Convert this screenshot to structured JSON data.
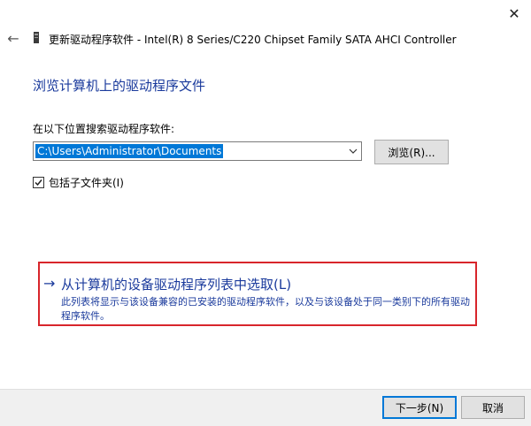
{
  "window": {
    "title": "更新驱动程序软件 - Intel(R) 8 Series/C220 Chipset Family SATA AHCI Controller",
    "close_glyph": "✕",
    "back_glyph": "←"
  },
  "page": {
    "heading": "浏览计算机上的驱动程序文件"
  },
  "search": {
    "label": "在以下位置搜索驱动程序软件:",
    "path_value": "C:\\Users\\Administrator\\Documents",
    "browse_label": "浏览(R)..."
  },
  "include_subfolders": {
    "label": "包括子文件夹(I)",
    "checked": true
  },
  "pick_option": {
    "arrow": "→",
    "title": "从计算机的设备驱动程序列表中选取(L)",
    "description": "此列表将显示与该设备兼容的已安装的驱动程序软件，以及与该设备处于同一类别下的所有驱动程序软件。"
  },
  "footer": {
    "next_label": "下一步(N)",
    "cancel_label": "取消"
  },
  "colors": {
    "link_blue": "#1a3a9c",
    "highlight_red": "#d8252b",
    "selection_blue": "#0078d7",
    "footer_bg": "#f0f0f0"
  }
}
